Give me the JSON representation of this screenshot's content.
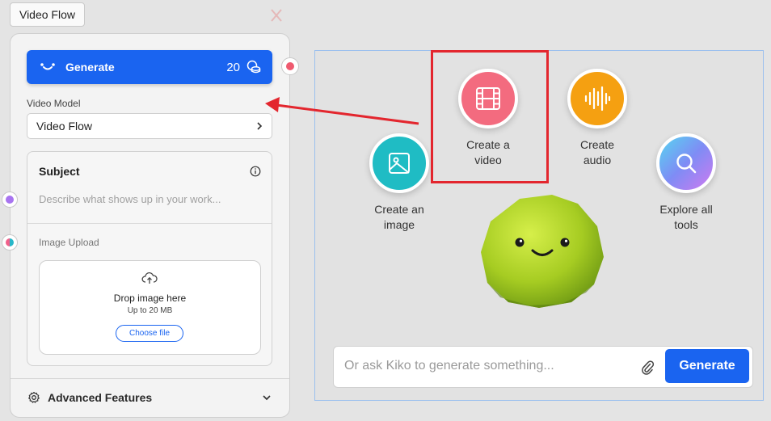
{
  "window": {
    "tab_title": "Video Flow"
  },
  "sidebar": {
    "generate_label": "Generate",
    "credits": "20",
    "model_label": "Video Model",
    "model_value": "Video Flow",
    "subject": {
      "title": "Subject",
      "placeholder": "Describe what shows up in your work..."
    },
    "upload": {
      "label": "Image Upload",
      "drop_text": "Drop image here",
      "limit": "Up to 20 MB",
      "choose_label": "Choose file"
    },
    "advanced_label": "Advanced Features"
  },
  "canvas": {
    "tools": [
      {
        "label_l1": "Create an",
        "label_l2": "image",
        "icon": "image-icon",
        "color": "#1fbcc4"
      },
      {
        "label_l1": "Create a",
        "label_l2": "video",
        "icon": "film-icon",
        "color": "#f36b7f"
      },
      {
        "label_l1": "Create",
        "label_l2": "audio",
        "icon": "waveform-icon",
        "color": "#f5a011"
      },
      {
        "label_l1": "Explore all",
        "label_l2": "tools",
        "icon": "search-icon",
        "color": "#8a7cf0"
      }
    ],
    "chat": {
      "placeholder": "Or ask Kiko to generate something...",
      "generate_label": "Generate"
    }
  },
  "colors": {
    "accent": "#1a64f0",
    "highlight": "#e3262e",
    "annotation_arrow": "#e3262e"
  }
}
